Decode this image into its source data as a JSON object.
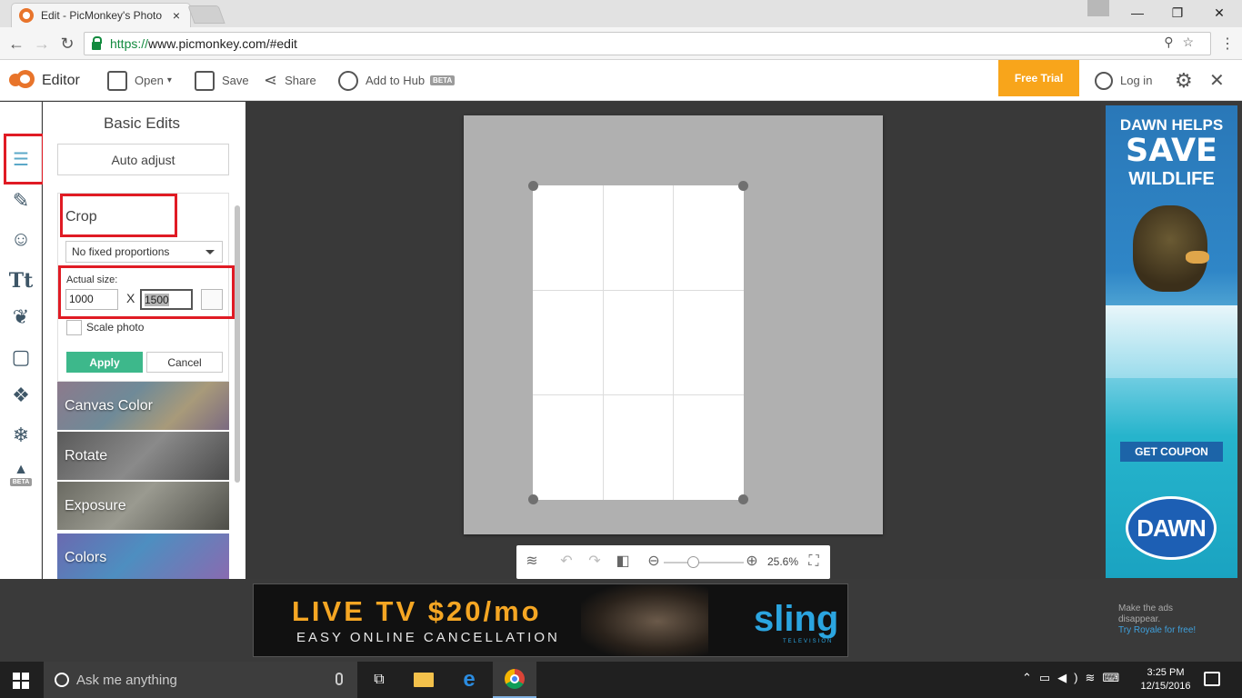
{
  "browser": {
    "tab_title": "Edit - PicMonkey's Photo",
    "tab_close": "×",
    "url_https": "https://",
    "url_rest": "www.picmonkey.com/#edit",
    "window_minimize": "—",
    "window_restore": "❐",
    "window_close": "✕"
  },
  "toolbar": {
    "editor_label": "Editor",
    "open_label": "Open",
    "save_label": "Save",
    "share_label": "Share",
    "add_to_hub_label": "Add to Hub",
    "beta_badge": "BETA",
    "free_trial_label": "Free Trial",
    "login_label": "Log in"
  },
  "rail": {
    "beta_badge": "BETA"
  },
  "panel": {
    "title": "Basic Edits",
    "auto_adjust_label": "Auto adjust",
    "crop": {
      "title": "Crop",
      "proportions_selected": "No fixed proportions",
      "actual_size_label": "Actual size:",
      "width_value": "1000",
      "separator": "X",
      "height_value": "1500",
      "scale_photo_label": "Scale photo",
      "apply_label": "Apply",
      "cancel_label": "Cancel"
    },
    "tiles": [
      {
        "label": "Canvas Color"
      },
      {
        "label": "Rotate"
      },
      {
        "label": "Exposure"
      },
      {
        "label": "Colors"
      }
    ]
  },
  "canvas": {
    "zoom_percent": "25.6%"
  },
  "side_ad": {
    "line1": "DAWN HELPS",
    "line2": "SAVE",
    "line3": "WILDLIFE",
    "coupon_label": "GET COUPON",
    "brand": "DAWN"
  },
  "bottom_ad": {
    "headline": "LIVE TV $20/mo",
    "subline": "EASY ONLINE CANCELLATION",
    "brand": "sling",
    "brand_sub": "TELEVISION",
    "note_line1": "Make the ads",
    "note_line2": "disappear.",
    "note_link": "Try Royale for free!"
  },
  "taskbar": {
    "search_placeholder": "Ask me anything",
    "time": "3:25 PM",
    "date": "12/15/2016"
  },
  "colors": {
    "accent_red": "#e01b24",
    "apply_green": "#3db88b",
    "free_trial_orange": "#f8a51b",
    "brand_orange": "#e8742b"
  }
}
